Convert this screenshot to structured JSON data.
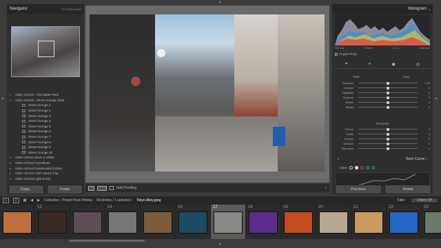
{
  "navigator": {
    "title": "Navigator",
    "zoom": "FIT  100%  200%"
  },
  "presets": [
    {
      "label": "Video School - Flat Matte Pack",
      "level": 0,
      "arrow": "▸"
    },
    {
      "label": "Video School - Street Grunge Style",
      "level": 0,
      "arrow": "▾"
    },
    {
      "label": "Street Grunge 1",
      "level": 1
    },
    {
      "label": "Street Grunge 2",
      "level": 1
    },
    {
      "label": "Street Grunge 3",
      "level": 1
    },
    {
      "label": "Street Grunge 4",
      "level": 1
    },
    {
      "label": "Street Grunge 5",
      "level": 1
    },
    {
      "label": "Street Grunge 6",
      "level": 1
    },
    {
      "label": "Street Grunge 7",
      "level": 1
    },
    {
      "label": "Street Grunge 8",
      "level": 1
    },
    {
      "label": "Street Grunge 9",
      "level": 1
    },
    {
      "label": "Street Grunge 10",
      "level": 1
    },
    {
      "label": "Video School Black & White",
      "level": 0,
      "arrow": "▸"
    },
    {
      "label": "Video School Cool Blues",
      "level": 0,
      "arrow": "▸"
    },
    {
      "label": "Video School Desaturated Colors",
      "level": 0,
      "arrow": "▸"
    },
    {
      "label": "Video School HDR Nature Pop",
      "level": 0,
      "arrow": "▸"
    },
    {
      "label": "Video School Light & Airy",
      "level": 0,
      "arrow": "▸"
    }
  ],
  "left_buttons": {
    "copy": "Copy...",
    "paste": "Paste"
  },
  "toolbar": {
    "soft_proofing": "Soft Proofing"
  },
  "histogram": {
    "title": "Histogram",
    "iso": "ISO 100",
    "focal": "26 mm",
    "aperture": "f / 1.8",
    "shutter": "1/400 sec",
    "original_photo": "Original Photo"
  },
  "tone": {
    "label": "Tone",
    "auto": "Auto",
    "sliders": [
      {
        "name": "Exposure",
        "value": "0.00",
        "pos": 0.5
      },
      {
        "name": "Contrast",
        "value": "0",
        "pos": 0.5
      },
      {
        "name": "Highlights",
        "value": "0",
        "pos": 0.5
      },
      {
        "name": "Shadows",
        "value": "0",
        "pos": 0.5
      },
      {
        "name": "Whites",
        "value": "0",
        "pos": 0.5
      },
      {
        "name": "Blacks",
        "value": "0",
        "pos": 0.5
      }
    ]
  },
  "presence": {
    "label": "Presence",
    "sliders": [
      {
        "name": "Texture",
        "value": "0",
        "pos": 0.5
      },
      {
        "name": "Clarity",
        "value": "0",
        "pos": 0.5
      },
      {
        "name": "Dehaze",
        "value": "0",
        "pos": 0.5
      },
      {
        "name": "Vibrance",
        "value": "0",
        "pos": 0.5
      },
      {
        "name": "Saturation",
        "value": "0",
        "pos": 0.5
      }
    ]
  },
  "tone_curve": {
    "title": "Tone Curve",
    "adjust": "Adjust"
  },
  "right_buttons": {
    "previous": "Previous",
    "reset": "Reset"
  },
  "filmstrip": {
    "page1": "1",
    "page2": "2",
    "source": "Collection : Preset Pack Photos",
    "count": "69 photos / 1 selected /",
    "file": "Tokyo Alley.jpeg",
    "filter_label": "Filter :",
    "filter_value": "Filters Off"
  },
  "thumbs": [
    {
      "num": "",
      "color": "#c0703a"
    },
    {
      "num": "12",
      "color": "#3a2a24"
    },
    {
      "num": "",
      "color": "#5e4d56"
    },
    {
      "num": "14",
      "color": "#777"
    },
    {
      "num": "",
      "color": "#7a5a3a"
    },
    {
      "num": "16",
      "color": "#1d4a64"
    },
    {
      "num": "17",
      "color": "#8a8885"
    },
    {
      "num": "18",
      "color": "#5a2d8a"
    },
    {
      "num": "19",
      "color": "#c24c1e"
    },
    {
      "num": "20",
      "color": "#b7a690"
    },
    {
      "num": "21",
      "color": "#c89a5e"
    },
    {
      "num": "22",
      "color": "#2466c4"
    },
    {
      "num": "23",
      "color": "#6a7a6a"
    }
  ]
}
